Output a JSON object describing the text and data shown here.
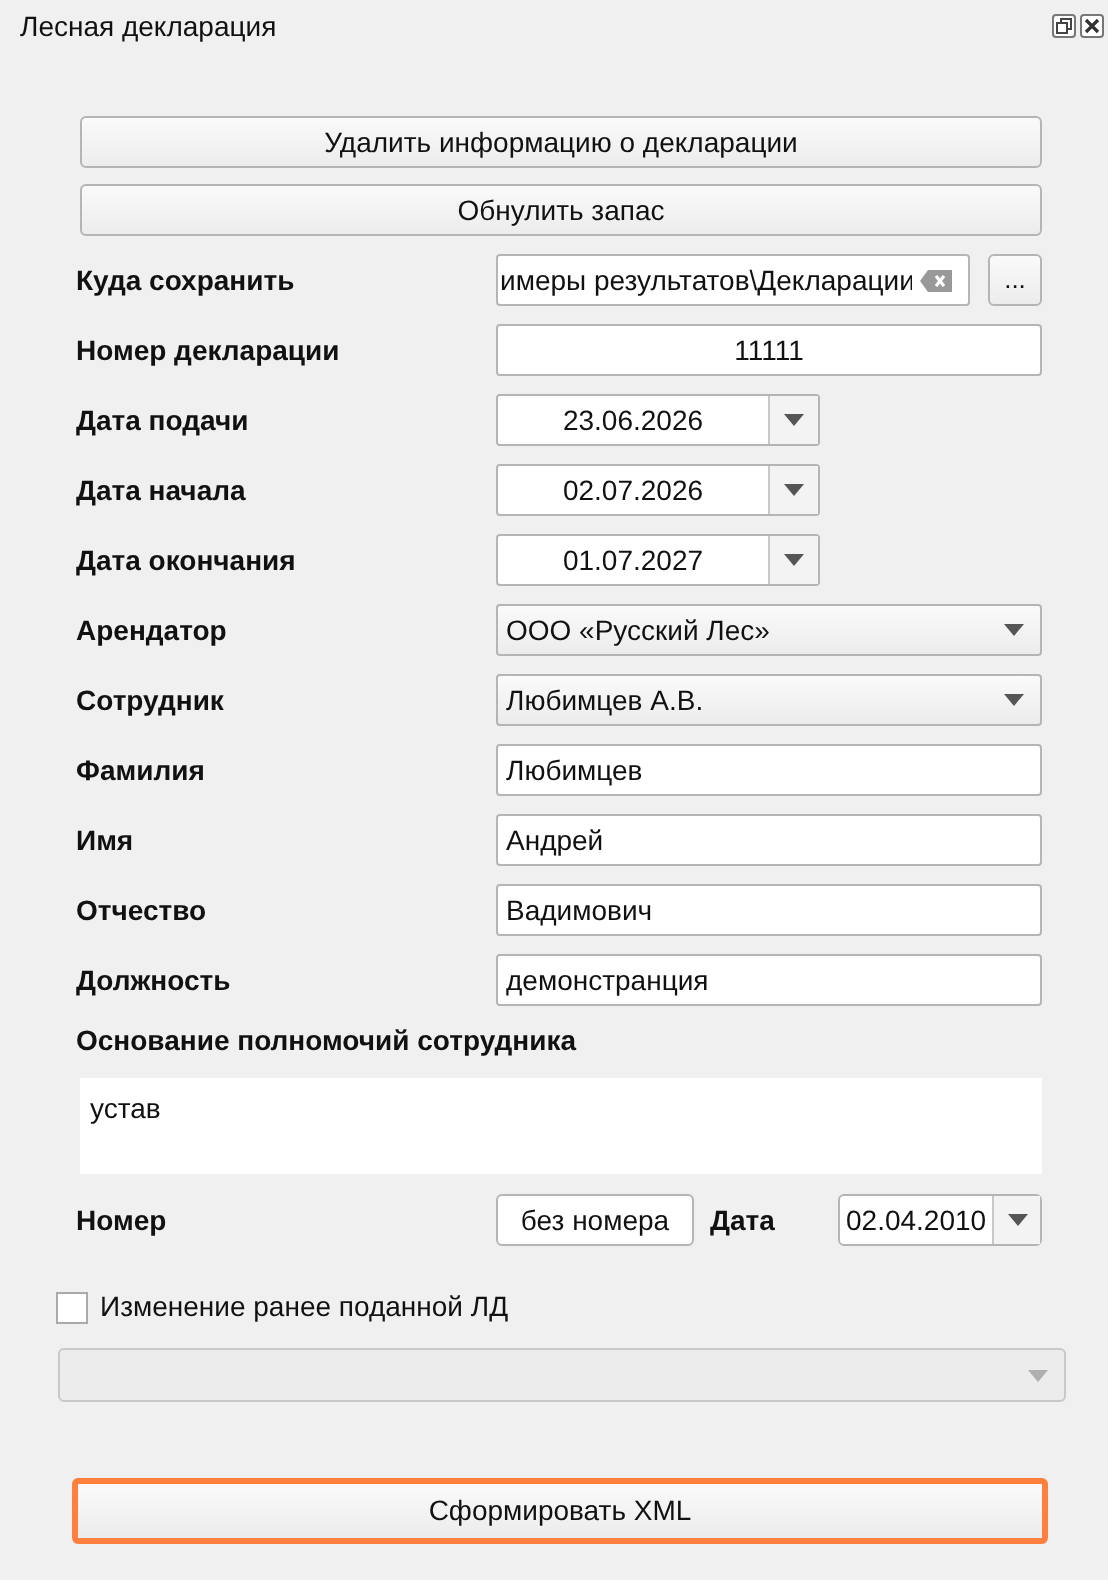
{
  "window": {
    "title": "Лесная декларация"
  },
  "top_buttons": [
    {
      "label": "Удалить информацию о декларации"
    },
    {
      "label": "Обнулить запас"
    }
  ],
  "fields": [
    {
      "kind": "path",
      "label": "Куда сохранить",
      "value": "имеры результатов\\Декларации",
      "browse": "..."
    },
    {
      "kind": "text",
      "label": "Номер декларации",
      "value": "11111",
      "centered": true
    },
    {
      "kind": "date",
      "label": "Дата подачи",
      "value": "23.06.2026"
    },
    {
      "kind": "date",
      "label": "Дата начала",
      "value": "02.07.2026"
    },
    {
      "kind": "date",
      "label": "Дата окончания",
      "value": "01.07.2027"
    },
    {
      "kind": "combo",
      "label": "Арендатор",
      "value": "ООО «Русский Лес»"
    },
    {
      "kind": "combo",
      "label": "Сотрудник",
      "value": "Любимцев А.В."
    },
    {
      "kind": "text",
      "label": "Фамилия",
      "value": "Любимцев",
      "centered": false
    },
    {
      "kind": "text",
      "label": "Имя",
      "value": "Андрей",
      "centered": false
    },
    {
      "kind": "text",
      "label": "Отчество",
      "value": "Вадимович",
      "centered": false
    },
    {
      "kind": "text",
      "label": "Должность",
      "value": "демонстранция",
      "centered": false
    }
  ],
  "authority": {
    "label": "Основание полномочий сотрудника",
    "value": "устав"
  },
  "number_row": {
    "number_label": "Номер",
    "number_value": "без номера",
    "date_label": "Дата",
    "date_value": "02.04.2010"
  },
  "change_checkbox": {
    "label": "Изменение ранее поданной ЛД",
    "checked": false
  },
  "change_combo": {
    "disabled": true
  },
  "generate_button": {
    "label": "Сформировать XML",
    "highlighted": true
  }
}
